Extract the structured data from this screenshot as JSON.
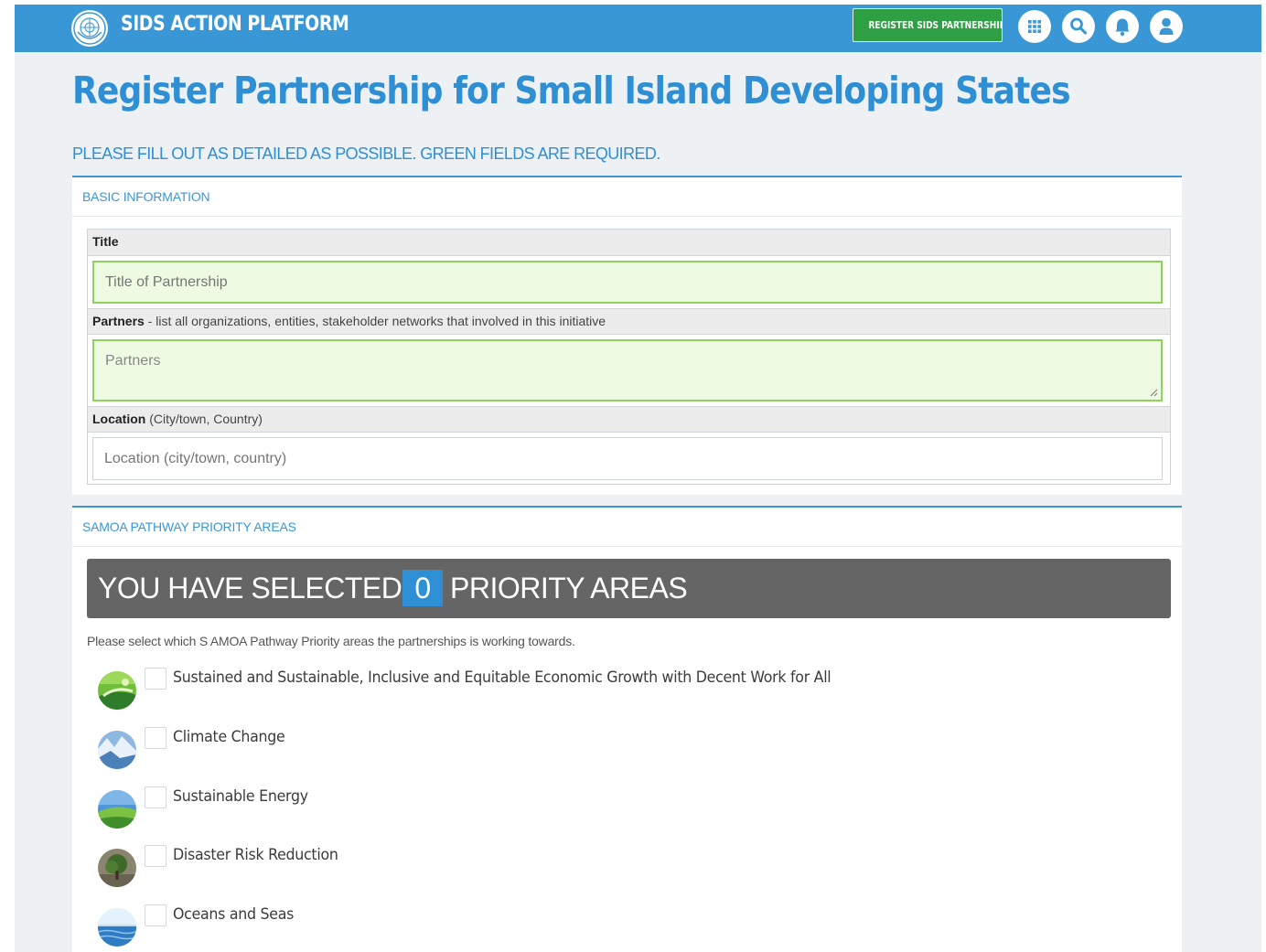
{
  "header": {
    "brand": "SIDS ACTION PLATFORM",
    "register_button": "REGISTER SIDS PARTNERSHIP",
    "icons": [
      "apps-grid-icon",
      "search-icon",
      "bell-icon",
      "user-icon"
    ],
    "color": "#3a97d6"
  },
  "page": {
    "title": "Register Partnership for Small Island Developing States",
    "subtitle": "PLEASE FILL OUT AS DETAILED AS POSSIBLE. GREEN FIELDS ARE REQUIRED."
  },
  "basic_info": {
    "heading": "BASIC INFORMATION",
    "title_label": "Title",
    "title_placeholder": "Title of Partnership",
    "partners_label": "Partners",
    "partners_hint": " - list all organizations, entities, stakeholder networks that involved in this initiative",
    "partners_placeholder": "Partners",
    "location_label": "Location",
    "location_hint": " (City/town, Country)",
    "location_placeholder": "Location (city/town, country)"
  },
  "priority": {
    "heading": "SAMOA PATHWAY PRIORITY AREAS",
    "selected_prefix": "YOU HAVE SELECTED:",
    "selected_count": "0",
    "selected_suffix": "PRIORITY AREAS",
    "instructions": "Please select which S AMOA Pathway Priority areas the partnerships is working towards.",
    "areas": [
      {
        "label": "Sustained and Sustainable, Inclusive and Equitable Economic Growth with Decent Work for All",
        "checked": false
      },
      {
        "label": "Climate Change",
        "checked": false
      },
      {
        "label": "Sustainable Energy",
        "checked": false
      },
      {
        "label": "Disaster Risk Reduction",
        "checked": false
      },
      {
        "label": "Oceans and Seas",
        "checked": false
      }
    ]
  },
  "colors": {
    "accent": "#3a97d6",
    "required_field_bg": "#edfbe2",
    "required_field_border": "#8fd35e",
    "register_button": "#2ea043",
    "selected_bar": "#656565"
  }
}
